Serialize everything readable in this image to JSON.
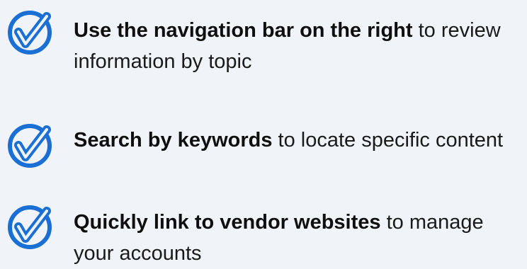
{
  "accent_color": "#1a6fd4",
  "items": [
    {
      "icon": "check-circle-icon",
      "bold": "Use the navigation bar on the right",
      "rest": " to review",
      "line2": "information by topic"
    },
    {
      "icon": "check-circle-icon",
      "bold": "Search by keywords",
      "rest": " to locate specific content",
      "line2": ""
    },
    {
      "icon": "check-circle-icon",
      "bold": "Quickly link to vendor websites",
      "rest": " to manage",
      "line2": "your accounts"
    }
  ]
}
